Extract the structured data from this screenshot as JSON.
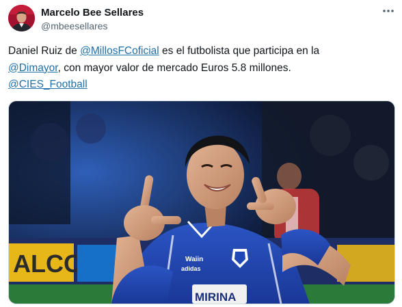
{
  "author": {
    "name": "Marcelo Bee Sellares",
    "handle": "@mbeesellares",
    "avatar_icon": "person-portrait-avatar"
  },
  "menu": {
    "icon": "more-horizontal-icon"
  },
  "tweet": {
    "line1_prefix": "Daniel Ruiz de ",
    "mention_millos": "@MillosFCoficial",
    "line1_suffix": " es el futbolista que participa en la",
    "mention_dimayor": "@Dimayor",
    "line2_suffix": ", con mayor valor de mercado Euros 5.8 millones.",
    "mention_cies": "@CIES_Football",
    "link_color": "#1d6fa5"
  },
  "media": {
    "kind": "photo",
    "shirt_sponsor": "MIRINA",
    "sponsor_left": "ALCO",
    "shirt_brand": "adidas",
    "sleeve_text": "Waiin"
  }
}
